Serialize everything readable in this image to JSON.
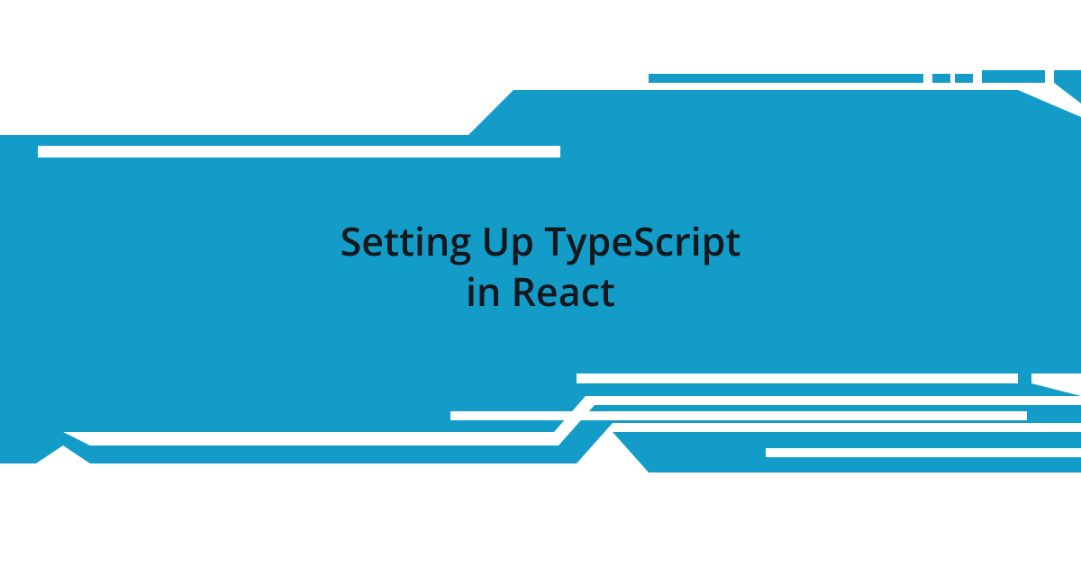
{
  "title_line1": "Setting Up TypeScript",
  "title_line2": "in React",
  "colors": {
    "primary": "#149cc9",
    "text": "#14181c",
    "background": "#ffffff"
  }
}
